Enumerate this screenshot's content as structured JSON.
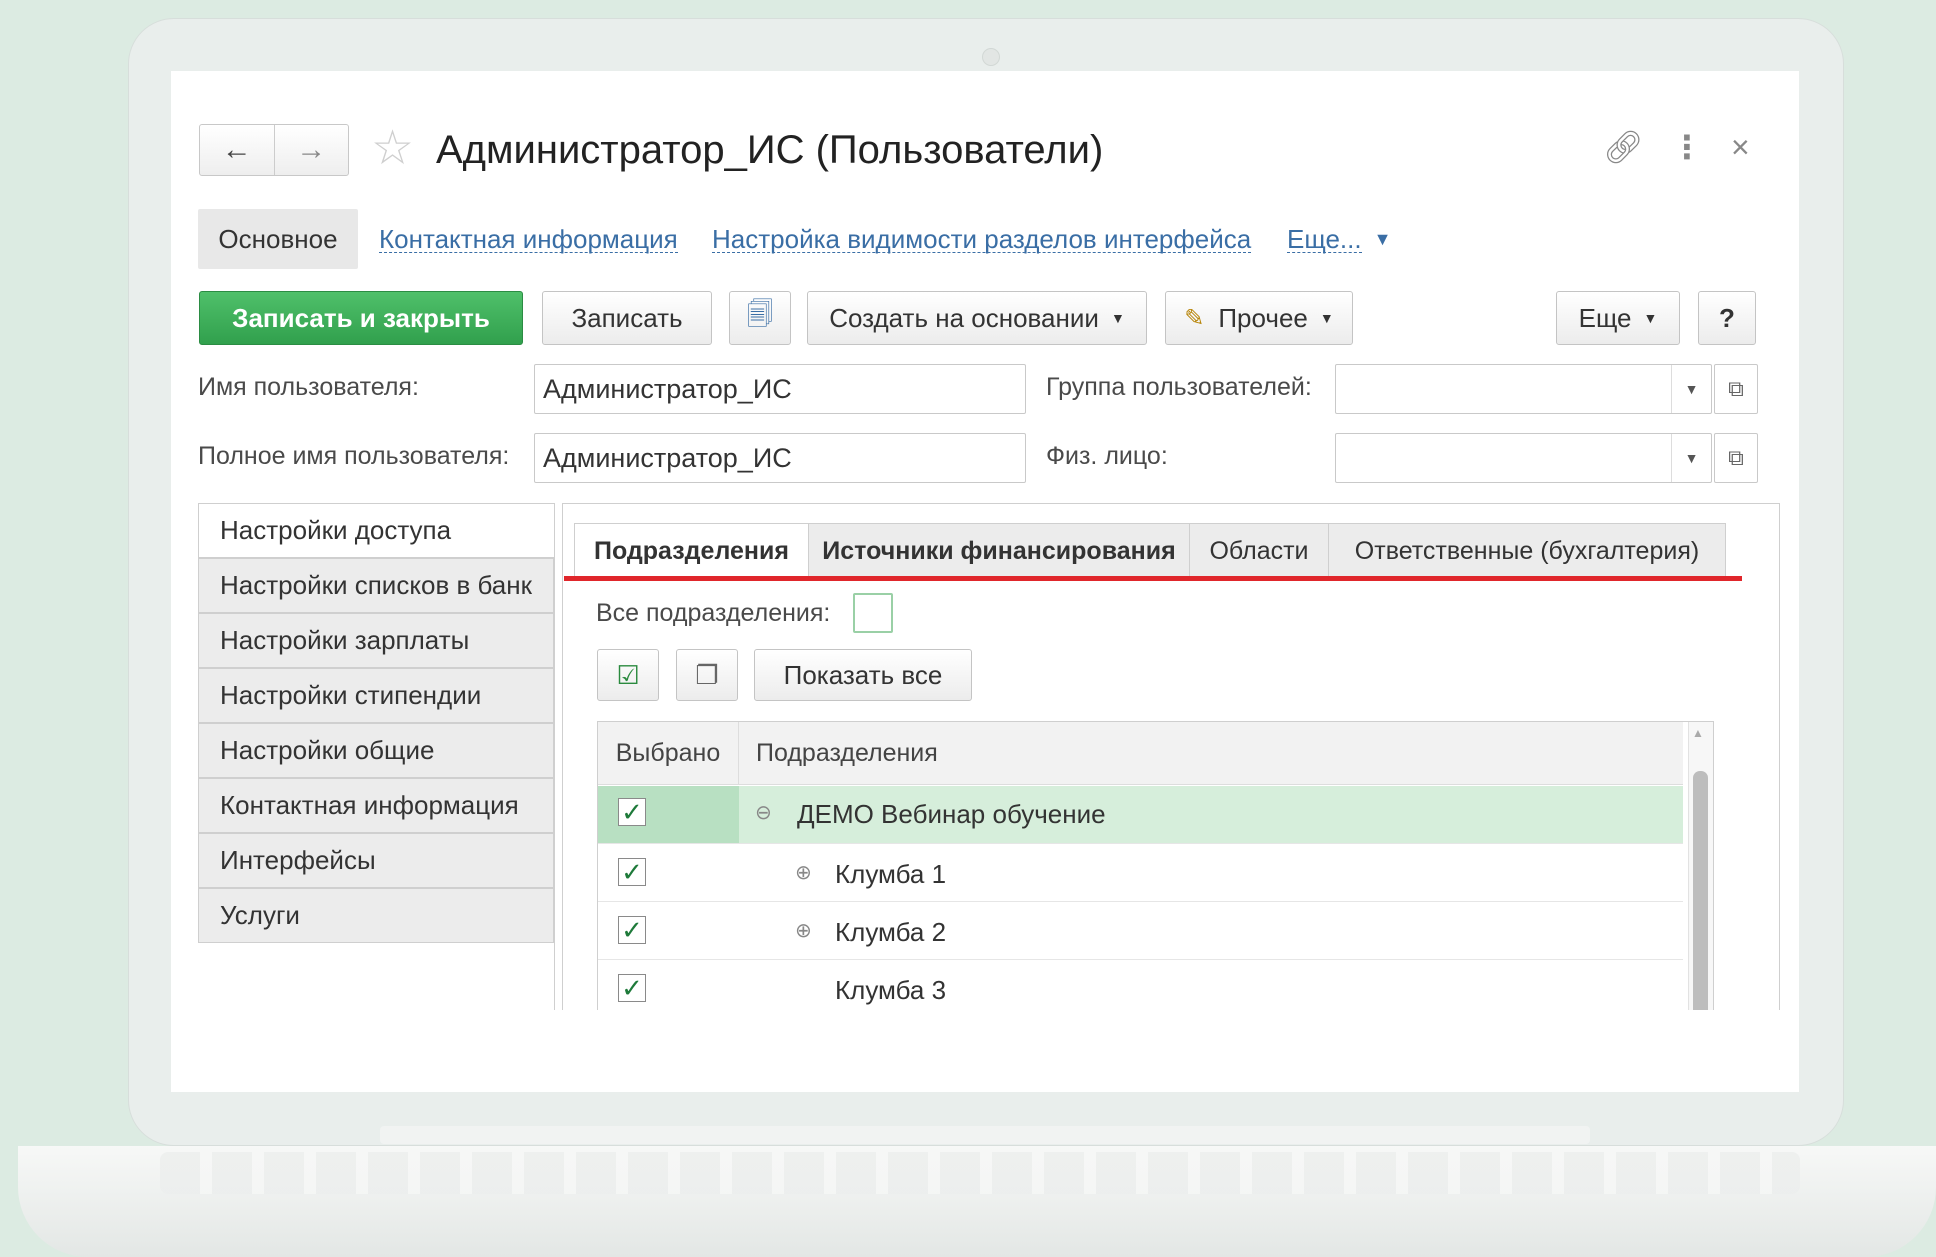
{
  "window": {
    "title": "Администратор_ИС (Пользователи)"
  },
  "top_nav": {
    "main": "Основное",
    "links": [
      "Контактная информация",
      "Настройка видимости разделов интерфейса",
      "Еще..."
    ]
  },
  "toolbar": {
    "save_close": "Записать и закрыть",
    "save": "Записать",
    "create_based": "Создать на основании",
    "other": "Прочее",
    "more": "Еще",
    "help": "?"
  },
  "form": {
    "username_label": "Имя пользователя:",
    "username_value": "Администратор_ИС",
    "fullname_label": "Полное имя пользователя:",
    "fullname_value": "Администратор_ИС",
    "group_label": "Группа пользователей:",
    "group_value": "",
    "person_label": "Физ. лицо:",
    "person_value": ""
  },
  "left_tabs": [
    "Настройки доступа",
    "Настройки списков в банк",
    "Настройки зарплаты",
    "Настройки стипендии",
    "Настройки общие",
    "Контактная информация",
    "Интерфейсы",
    "Услуги"
  ],
  "inner_tabs": [
    "Подразделения",
    "Источники финансирования",
    "Области",
    "Ответственные (бухгалтерия)"
  ],
  "departments": {
    "all_label": "Все подразделения:",
    "all_checked": false,
    "show_all": "Показать все",
    "columns": [
      "Выбрано",
      "Подразделения"
    ],
    "rows": [
      {
        "selected": true,
        "name": "ДЕМО Вебинар обучение",
        "tree": "⊖"
      },
      {
        "selected": true,
        "name": "Клумба 1",
        "tree": "⊕"
      },
      {
        "selected": true,
        "name": "Клумба 2",
        "tree": "⊕"
      },
      {
        "selected": true,
        "name": "Клумба 3",
        "tree": ""
      }
    ]
  }
}
